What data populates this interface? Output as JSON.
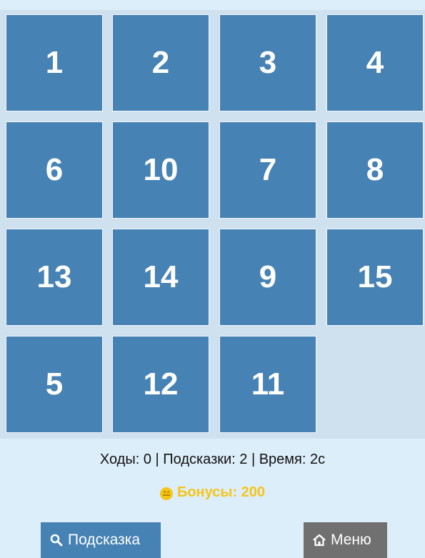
{
  "board": {
    "tiles": [
      {
        "label": "1",
        "row": 0,
        "col": 0
      },
      {
        "label": "2",
        "row": 0,
        "col": 1
      },
      {
        "label": "3",
        "row": 0,
        "col": 2
      },
      {
        "label": "4",
        "row": 0,
        "col": 3
      },
      {
        "label": "6",
        "row": 1,
        "col": 0
      },
      {
        "label": "10",
        "row": 1,
        "col": 1
      },
      {
        "label": "7",
        "row": 1,
        "col": 2
      },
      {
        "label": "8",
        "row": 1,
        "col": 3
      },
      {
        "label": "13",
        "row": 2,
        "col": 0
      },
      {
        "label": "14",
        "row": 2,
        "col": 1
      },
      {
        "label": "9",
        "row": 2,
        "col": 2
      },
      {
        "label": "15",
        "row": 2,
        "col": 3
      },
      {
        "label": "5",
        "row": 3,
        "col": 0
      },
      {
        "label": "12",
        "row": 3,
        "col": 1
      },
      {
        "label": "11",
        "row": 3,
        "col": 2
      }
    ],
    "empty": {
      "row": 3,
      "col": 3
    }
  },
  "stats": {
    "text": "Ходы: 0 | Подсказки: 2 | Время: 2с"
  },
  "bonus": {
    "text": "Бонусы: 200",
    "icon": "coin-smiley-icon"
  },
  "buttons": {
    "hint_label": "Подсказка",
    "hint_icon": "magnifier-icon",
    "menu_label": "Меню",
    "menu_icon": "home-icon"
  },
  "colors": {
    "tile": "#4682b4",
    "background": "#ddeefb",
    "board": "#cfe0ef",
    "bonus": "#f5c518",
    "menu_button": "#707070"
  }
}
